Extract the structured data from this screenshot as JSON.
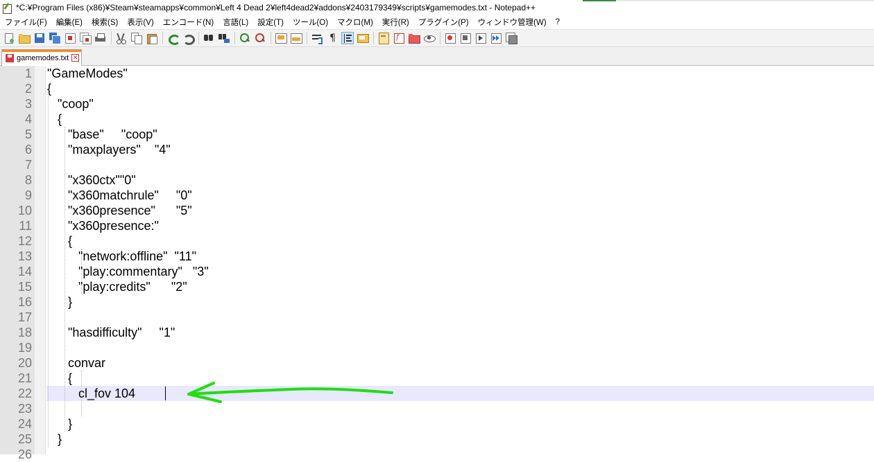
{
  "window": {
    "title": "*C:¥Program Files (x86)¥Steam¥steamapps¥common¥Left 4 Dead 2¥left4dead2¥addons¥2403179349¥scripts¥gamemodes.txt - Notepad++"
  },
  "menu": [
    "ファイル(F)",
    "編集(E)",
    "検索(S)",
    "表示(V)",
    "エンコード(N)",
    "言語(L)",
    "設定(T)",
    "ツール(O)",
    "マクロ(M)",
    "実行(R)",
    "プラグイン(P)",
    "ウィンドウ管理(W)",
    "?"
  ],
  "toolbar": {
    "icons": [
      "new-file-icon",
      "open-file-icon",
      "save-icon",
      "save-all-icon",
      "close-icon",
      "close-all-icon",
      "print-icon",
      "cut-icon",
      "copy-icon",
      "paste-icon",
      "undo-icon",
      "redo-icon",
      "find-icon",
      "replace-icon",
      "zoom-in-icon",
      "zoom-out-icon",
      "sync-vertical-icon",
      "sync-horizontal-icon",
      "word-wrap-icon",
      "show-all-characters-icon",
      "indent-guide-icon",
      "define-language-icon",
      "document-map-icon",
      "function-list-icon",
      "folder-workspace-icon",
      "monitoring-icon",
      "record-macro-icon",
      "stop-recording-icon",
      "play-macro-icon",
      "run-macro-multiple-icon",
      "save-macro-icon"
    ]
  },
  "tab": {
    "label": "gamemodes.txt"
  },
  "editor": {
    "lines": [
      {
        "n": "1",
        "text": "\"GameModes\""
      },
      {
        "n": "2",
        "text": "{"
      },
      {
        "n": "3",
        "text": "   \"coop\""
      },
      {
        "n": "4",
        "text": "   {"
      },
      {
        "n": "5",
        "text": "      \"base\"     \"coop\""
      },
      {
        "n": "6",
        "text": "      \"maxplayers\"    \"4\""
      },
      {
        "n": "7",
        "text": ""
      },
      {
        "n": "8",
        "text": "      \"x360ctx\"\"0\""
      },
      {
        "n": "9",
        "text": "      \"x360matchrule\"     \"0\""
      },
      {
        "n": "10",
        "text": "      \"x360presence\"      \"5\""
      },
      {
        "n": "11",
        "text": "      \"x360presence:\""
      },
      {
        "n": "12",
        "text": "      {"
      },
      {
        "n": "13",
        "text": "         \"network:offline\"  \"11\""
      },
      {
        "n": "14",
        "text": "         \"play:commentary\"   \"3\""
      },
      {
        "n": "15",
        "text": "         \"play:credits\"      \"2\""
      },
      {
        "n": "16",
        "text": "      }"
      },
      {
        "n": "17",
        "text": ""
      },
      {
        "n": "18",
        "text": "      \"hasdifficulty\"     \"1\""
      },
      {
        "n": "19",
        "text": ""
      },
      {
        "n": "20",
        "text": "      convar"
      },
      {
        "n": "21",
        "text": "      {"
      },
      {
        "n": "22",
        "text": "         cl_fov 104"
      },
      {
        "n": "23",
        "text": ""
      },
      {
        "n": "24",
        "text": "      }"
      },
      {
        "n": "25",
        "text": "   }"
      },
      {
        "n": "26",
        "text": ""
      }
    ]
  },
  "annotation": {
    "color": "#22dd11"
  }
}
